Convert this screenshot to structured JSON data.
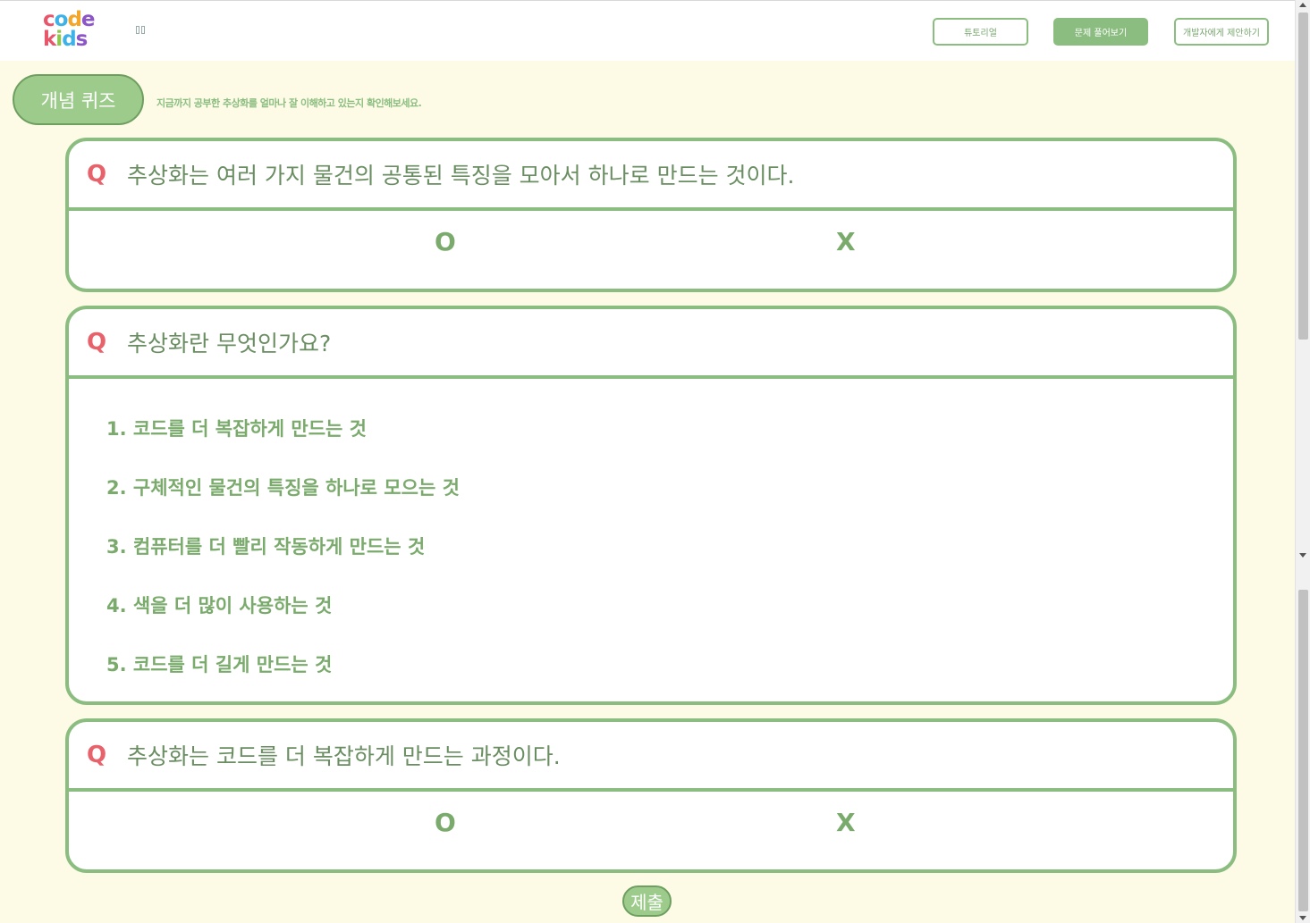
{
  "header": {
    "logo_top": "code",
    "logo_bottom": "kids",
    "nav": {
      "tutorial": "튜토리얼",
      "solve": "문제 풀어보기",
      "suggest": "개발자에게 제안하기"
    }
  },
  "page": {
    "title": "개념 퀴즈",
    "subtitle": "지금까지 공부한 추상화를 얼마나 잘 이해하고 있는지 확인해보세요."
  },
  "questions": [
    {
      "mark": "Q",
      "text": "추상화는 여러 가지 물건의 공통된 특징을 모아서 하나로 만드는 것이다.",
      "o": "O",
      "x": "X"
    },
    {
      "mark": "Q",
      "text": "추상화란 무엇인가요?",
      "options": [
        "1. 코드를 더 복잡하게 만드는 것",
        "2. 구체적인 물건의 특징을 하나로 모으는 것",
        "3. 컴퓨터를 더 빨리 작동하게 만드는 것",
        "4. 색을 더 많이 사용하는 것",
        "5. 코드를 더 길게 만드는 것"
      ]
    },
    {
      "mark": "Q",
      "text": "추상화는 코드를 더 복잡하게 만드는 과정이다.",
      "o": "O",
      "x": "X"
    }
  ],
  "submit_label": "제출",
  "colors": {
    "accent": "#8bbd80",
    "q_mark": "#e8626b",
    "background": "#fdfbe6"
  }
}
